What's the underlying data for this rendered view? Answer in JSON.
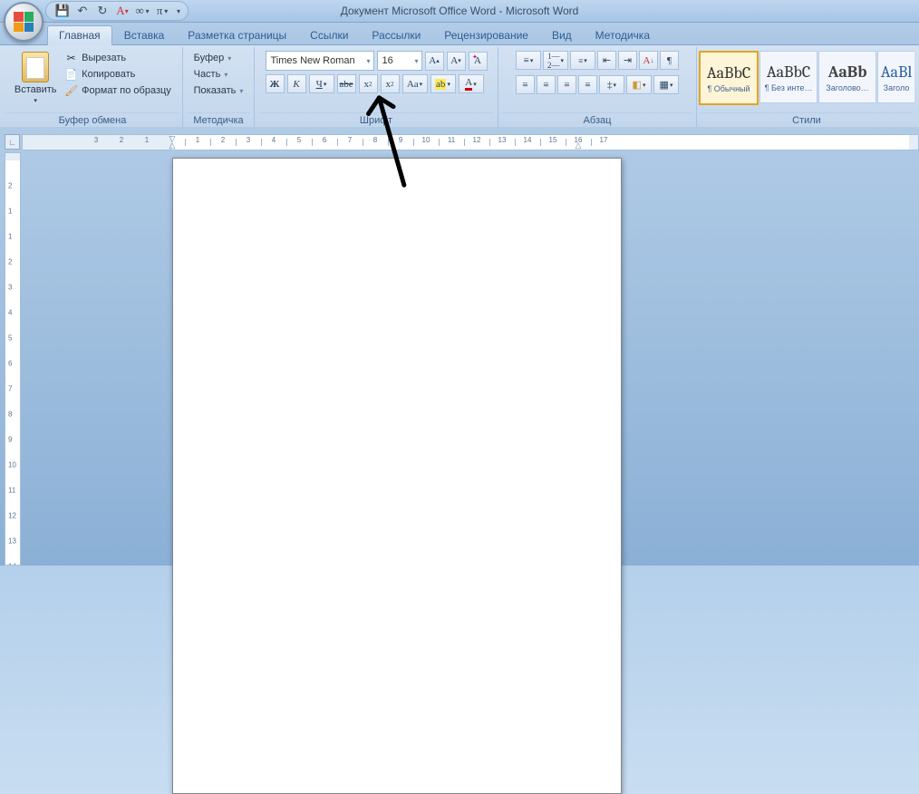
{
  "title": "Документ Microsoft Office Word - Microsoft Word",
  "qat": {
    "save_tip": "Сохранить",
    "undo_tip": "Отменить",
    "redo_tip": "Повторить"
  },
  "tabs": [
    {
      "label": "Главная",
      "active": true
    },
    {
      "label": "Вставка"
    },
    {
      "label": "Разметка страницы"
    },
    {
      "label": "Ссылки"
    },
    {
      "label": "Рассылки"
    },
    {
      "label": "Рецензирование"
    },
    {
      "label": "Вид"
    },
    {
      "label": "Методичка"
    }
  ],
  "ribbon": {
    "clipboard": {
      "paste": "Вставить",
      "cut": "Вырезать",
      "copy": "Копировать",
      "format_painter": "Формат по образцу",
      "label": "Буфер обмена"
    },
    "method": {
      "bufer": "Буфер",
      "chast": "Часть",
      "show": "Показать",
      "label": "Методичка"
    },
    "font": {
      "name": "Times New Roman",
      "size": "16",
      "label": "Шрифт"
    },
    "paragraph": {
      "label": "Абзац"
    },
    "styles": {
      "items": [
        {
          "preview": "AaBbC",
          "caption": "¶ Обычный",
          "selected": true,
          "accent": "#d7833a"
        },
        {
          "preview": "AaBbC",
          "caption": "¶ Без инте…",
          "selected": false,
          "accent": "#333"
        },
        {
          "preview": "AaBb",
          "caption": "Заголово…",
          "selected": false,
          "bold": true
        },
        {
          "preview": "AaBl",
          "caption": "Заголо",
          "selected": false,
          "bold": false
        }
      ],
      "label": "Стили"
    }
  },
  "ruler": {
    "h_numbers": [
      3,
      2,
      1,
      1,
      2,
      3,
      4,
      5,
      6,
      7,
      8,
      9,
      10,
      11,
      12,
      13,
      14,
      15,
      16,
      17
    ],
    "v_numbers": [
      2,
      1,
      1,
      2,
      3,
      4,
      5,
      6,
      7,
      8,
      9,
      10,
      11,
      12,
      13
    ]
  }
}
